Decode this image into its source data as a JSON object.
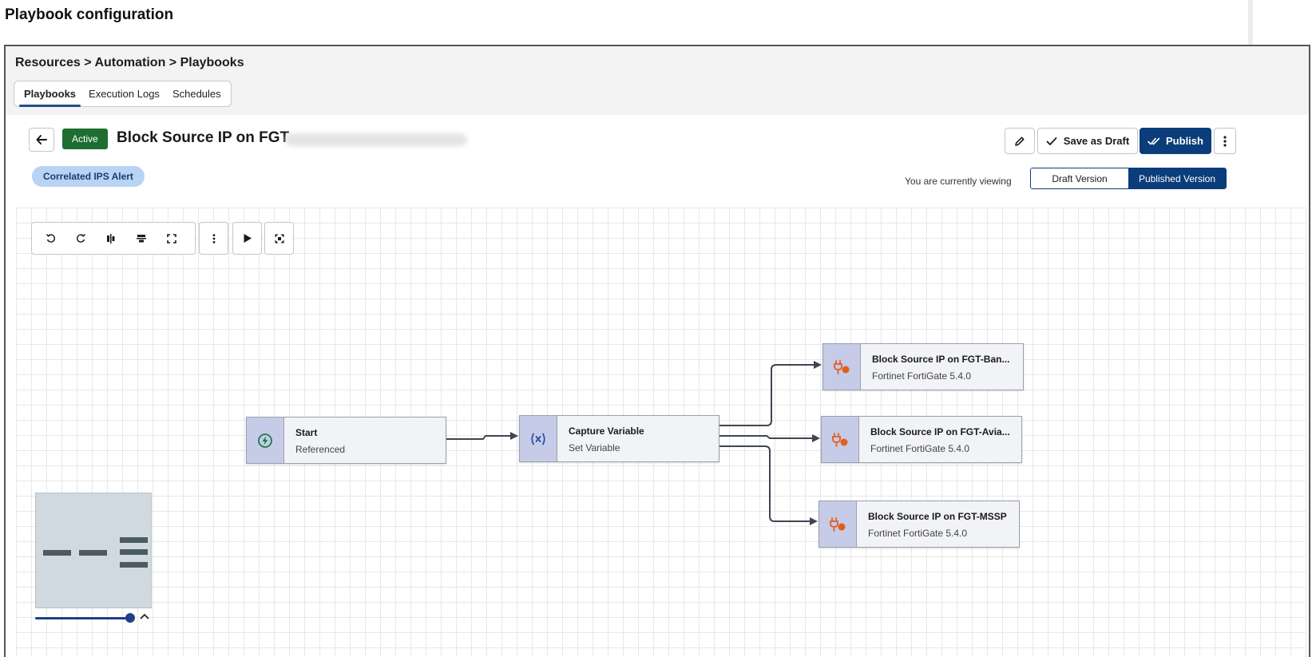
{
  "page_heading": "Playbook configuration",
  "breadcrumb": "Resources > Automation > Playbooks",
  "tabs": [
    {
      "label": "Playbooks",
      "active": true
    },
    {
      "label": "Execution Logs",
      "active": false
    },
    {
      "label": "Schedules",
      "active": false
    }
  ],
  "header": {
    "status": "Active",
    "title": "Block Source IP on FGT",
    "tag": "Correlated IPS Alert",
    "save_draft_label": "Save as Draft",
    "publish_label": "Publish"
  },
  "viewing": {
    "label": "You are currently viewing",
    "draft": "Draft Version",
    "published": "Published Version",
    "selected": "published"
  },
  "nodes": {
    "start": {
      "title": "Start",
      "subtitle": "Referenced",
      "icon": "lightning-icon"
    },
    "capture": {
      "title": "Capture Variable",
      "subtitle": "Set Variable",
      "icon": "variable-icon"
    },
    "action1": {
      "title": "Block Source IP on FGT-Ban...",
      "subtitle": "Fortinet FortiGate 5.4.0",
      "icon": "plug-icon"
    },
    "action2": {
      "title": "Block Source IP on FGT-Avia...",
      "subtitle": "Fortinet FortiGate 5.4.0",
      "icon": "plug-icon"
    },
    "action3": {
      "title": "Block Source IP on FGT-MSSP",
      "subtitle": "Fortinet FortiGate 5.4.0",
      "icon": "plug-icon"
    }
  },
  "zoom_level": 0.95,
  "colors": {
    "active_badge": "#1e6e32",
    "publish": "#0a3d7a",
    "tag_chip": "#b9d3f5",
    "node_icon_bg": "#c6cbe8",
    "plug_icon": "#e0601b"
  }
}
